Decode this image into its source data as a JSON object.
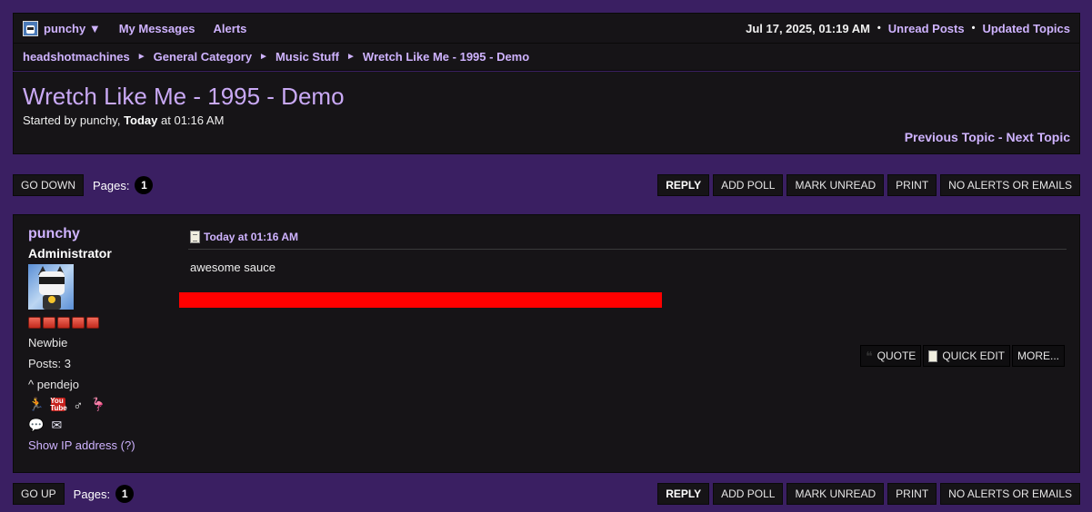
{
  "topbar": {
    "username": "punchy ▼",
    "my_messages": "My Messages",
    "alerts": "Alerts",
    "datetime": "Jul 17, 2025, 01:19 AM",
    "unread_posts": "Unread Posts",
    "updated_topics": "Updated Topics",
    "separator": "•"
  },
  "breadcrumb": {
    "items": [
      "headshotmachines",
      "General Category",
      "Music Stuff",
      "Wretch Like Me - 1995 - Demo"
    ],
    "separator": "►"
  },
  "topic": {
    "title": "Wretch Like Me - 1995 - Demo",
    "started_prefix": "Started by punchy,",
    "started_day": "Today",
    "started_time": "at 01:16 AM",
    "previous": "Previous Topic",
    "dash": "-",
    "next": "Next Topic"
  },
  "controls_top": {
    "go_label": "GO DOWN",
    "pages_label": "Pages:",
    "page": "1"
  },
  "controls_bottom": {
    "go_label": "GO UP",
    "pages_label": "Pages:",
    "page": "1"
  },
  "actions": {
    "reply": "REPLY",
    "add_poll": "ADD POLL",
    "mark_unread": "MARK UNREAD",
    "print": "PRINT",
    "no_alerts": "NO ALERTS OR EMAILS"
  },
  "post": {
    "author": "punchy",
    "role": "Administrator",
    "rank": "Newbie",
    "posts": "Posts: 3",
    "personal_text": "^ pendejo",
    "show_ip": "Show IP address (?)",
    "timestamp": "Today at 01:16 AM",
    "body": "awesome sauce",
    "quote": "QUOTE",
    "quick_edit": "QUICK EDIT",
    "more": "MORE...",
    "redaction_color": "#ff0000",
    "star_count": 5
  },
  "colors": {
    "background": "#3a1f62",
    "panel": "#161417",
    "link": "#cfb3ff",
    "title": "#c9a9f5"
  }
}
